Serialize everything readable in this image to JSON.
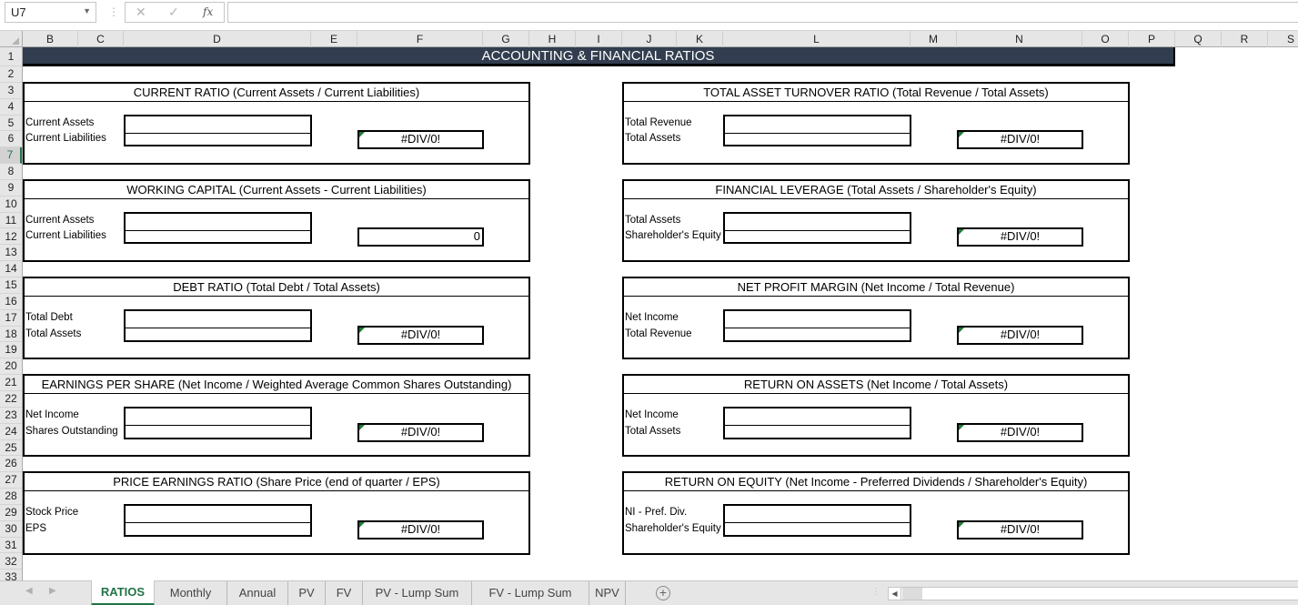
{
  "formula_bar": {
    "name_box": "U7",
    "cancel_icon": "✕",
    "enter_icon": "✓",
    "fx_label": "fx",
    "formula": ""
  },
  "columns": [
    "B",
    "C",
    "D",
    "E",
    "F",
    "G",
    "H",
    "I",
    "J",
    "K",
    "L",
    "M",
    "N",
    "O",
    "P",
    "Q",
    "R",
    "S"
  ],
  "rows": [
    "1",
    "2",
    "3",
    "4",
    "5",
    "6",
    "7",
    "8",
    "9",
    "10",
    "11",
    "12",
    "13",
    "14",
    "15",
    "16",
    "17",
    "18",
    "19",
    "20",
    "21",
    "22",
    "23",
    "24",
    "25",
    "26",
    "27",
    "28",
    "29",
    "30",
    "31",
    "32",
    "33"
  ],
  "active_row": "7",
  "banner": {
    "title": "ACCOUNTING & FINANCIAL RATIOS",
    "color": "#323e4f"
  },
  "cards": [
    {
      "title": "CURRENT RATIO (Current Assets / Current Liabilities)",
      "input1_label": "Current Assets",
      "input2_label": "Current Liabilities",
      "input1_value": "",
      "input2_value": "",
      "result": "#DIV/0!"
    },
    {
      "title": "WORKING CAPITAL (Current Assets - Current Liabilities)",
      "input1_label": "Current Assets",
      "input2_label": "Current Liabilities",
      "input1_value": "",
      "input2_value": "",
      "result": "0"
    },
    {
      "title": "DEBT RATIO (Total Debt / Total Assets)",
      "input1_label": "Total Debt",
      "input2_label": "Total Assets",
      "input1_value": "",
      "input2_value": "",
      "result": "#DIV/0!"
    },
    {
      "title": "EARNINGS PER SHARE (Net Income / Weighted Average Common Shares Outstanding)",
      "input1_label": "Net Income",
      "input2_label": "Shares Outstanding",
      "input1_value": "",
      "input2_value": "",
      "result": "#DIV/0!"
    },
    {
      "title": "PRICE EARNINGS RATIO (Share Price (end of quarter / EPS)",
      "input1_label": "Stock Price",
      "input2_label": "EPS",
      "input1_value": "",
      "input2_value": "",
      "result": "#DIV/0!"
    },
    {
      "title": "TOTAL ASSET TURNOVER RATIO (Total Revenue / Total Assets)",
      "input1_label": "Total Revenue",
      "input2_label": "Total Assets",
      "input1_value": "",
      "input2_value": "",
      "result": "#DIV/0!"
    },
    {
      "title": "FINANCIAL LEVERAGE (Total Assets / Shareholder's Equity)",
      "input1_label": "Total Assets",
      "input2_label": "Shareholder's Equity",
      "input1_value": "",
      "input2_value": "",
      "result": "#DIV/0!"
    },
    {
      "title": "NET PROFIT MARGIN (Net Income / Total Revenue)",
      "input1_label": "Net Income",
      "input2_label": "Total Revenue",
      "input1_value": "",
      "input2_value": "",
      "result": "#DIV/0!"
    },
    {
      "title": "RETURN ON ASSETS (Net Income / Total Assets)",
      "input1_label": "Net Income",
      "input2_label": "Total Assets",
      "input1_value": "",
      "input2_value": "",
      "result": "#DIV/0!"
    },
    {
      "title": "RETURN ON EQUITY (Net Income - Preferred Dividends / Shareholder's Equity)",
      "input1_label": "NI - Pref. Div.",
      "input2_label": "Shareholder's Equity",
      "input1_value": "",
      "input2_value": "",
      "result": "#DIV/0!"
    }
  ],
  "sheet_tabs": {
    "prev_icon": "◀",
    "next_icon": "▶",
    "tabs": [
      "RATIOS",
      "Monthly",
      "Annual",
      "PV",
      "FV",
      "PV - Lump Sum",
      "FV - Lump Sum",
      "NPV"
    ],
    "active": "RATIOS",
    "add_icon": "+",
    "scroll_left_icon": "◀"
  }
}
